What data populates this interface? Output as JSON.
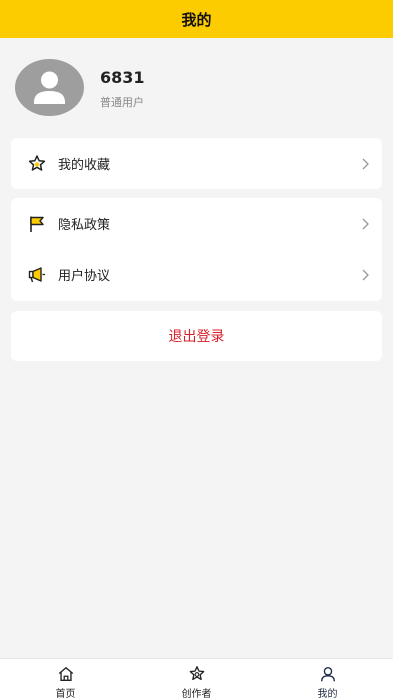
{
  "header": {
    "title": "我的"
  },
  "profile": {
    "username": "6831",
    "role": "普通用户"
  },
  "menu": {
    "favorites": {
      "label": "我的收藏",
      "icon": "star-badge-icon"
    },
    "privacy": {
      "label": "隐私政策",
      "icon": "flag-icon"
    },
    "agreement": {
      "label": "用户协议",
      "icon": "megaphone-icon"
    }
  },
  "logout": {
    "label": "退出登录"
  },
  "tabbar": {
    "tabs": [
      {
        "label": "首页",
        "icon": "home-icon"
      },
      {
        "label": "创作者",
        "icon": "star-badge-icon"
      },
      {
        "label": "我的",
        "icon": "user-icon",
        "active": true
      }
    ]
  },
  "colors": {
    "header": "#fccc00",
    "logout_text": "#d8202a",
    "avatar": "#9e9e9e"
  }
}
